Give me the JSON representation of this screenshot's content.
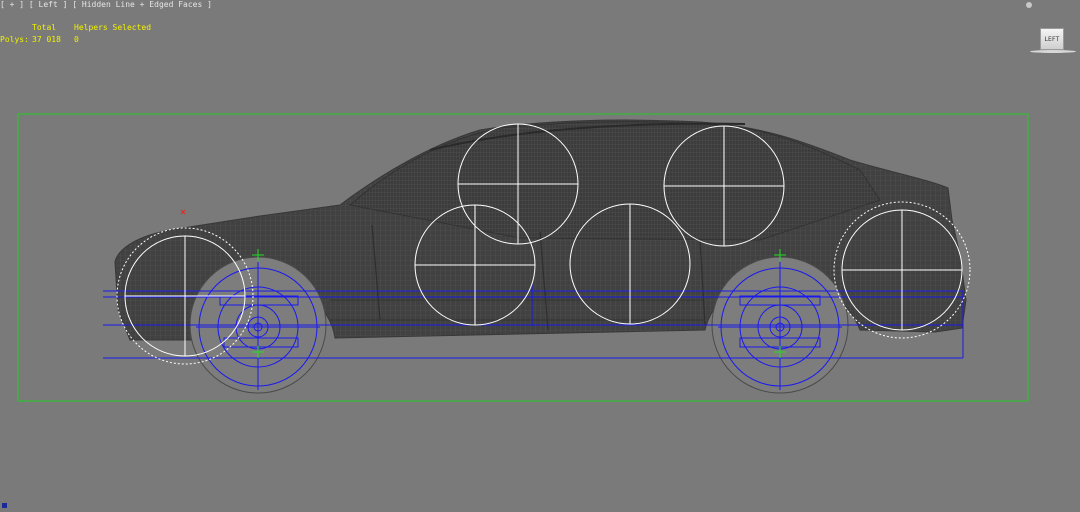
{
  "viewport": {
    "label": "[ + ] [ Left ] [ Hidden Line + Edged Faces ]"
  },
  "stats": {
    "header": [
      "Total",
      "Helpers Selected"
    ],
    "rows": [
      {
        "label": "Polys:",
        "total": "37 018",
        "selected": "0"
      }
    ]
  },
  "view_cube": {
    "face_label": "LEFT"
  },
  "colors": {
    "viewport_bg": "#7a7a7a",
    "mesh": "#3e3e3e",
    "mesh_lines": "#555555",
    "bounding_box": "#22cc22",
    "helper_circles": "#ffffff",
    "rig_lines": "#1a1aee",
    "stats_text": "#f2f200"
  }
}
